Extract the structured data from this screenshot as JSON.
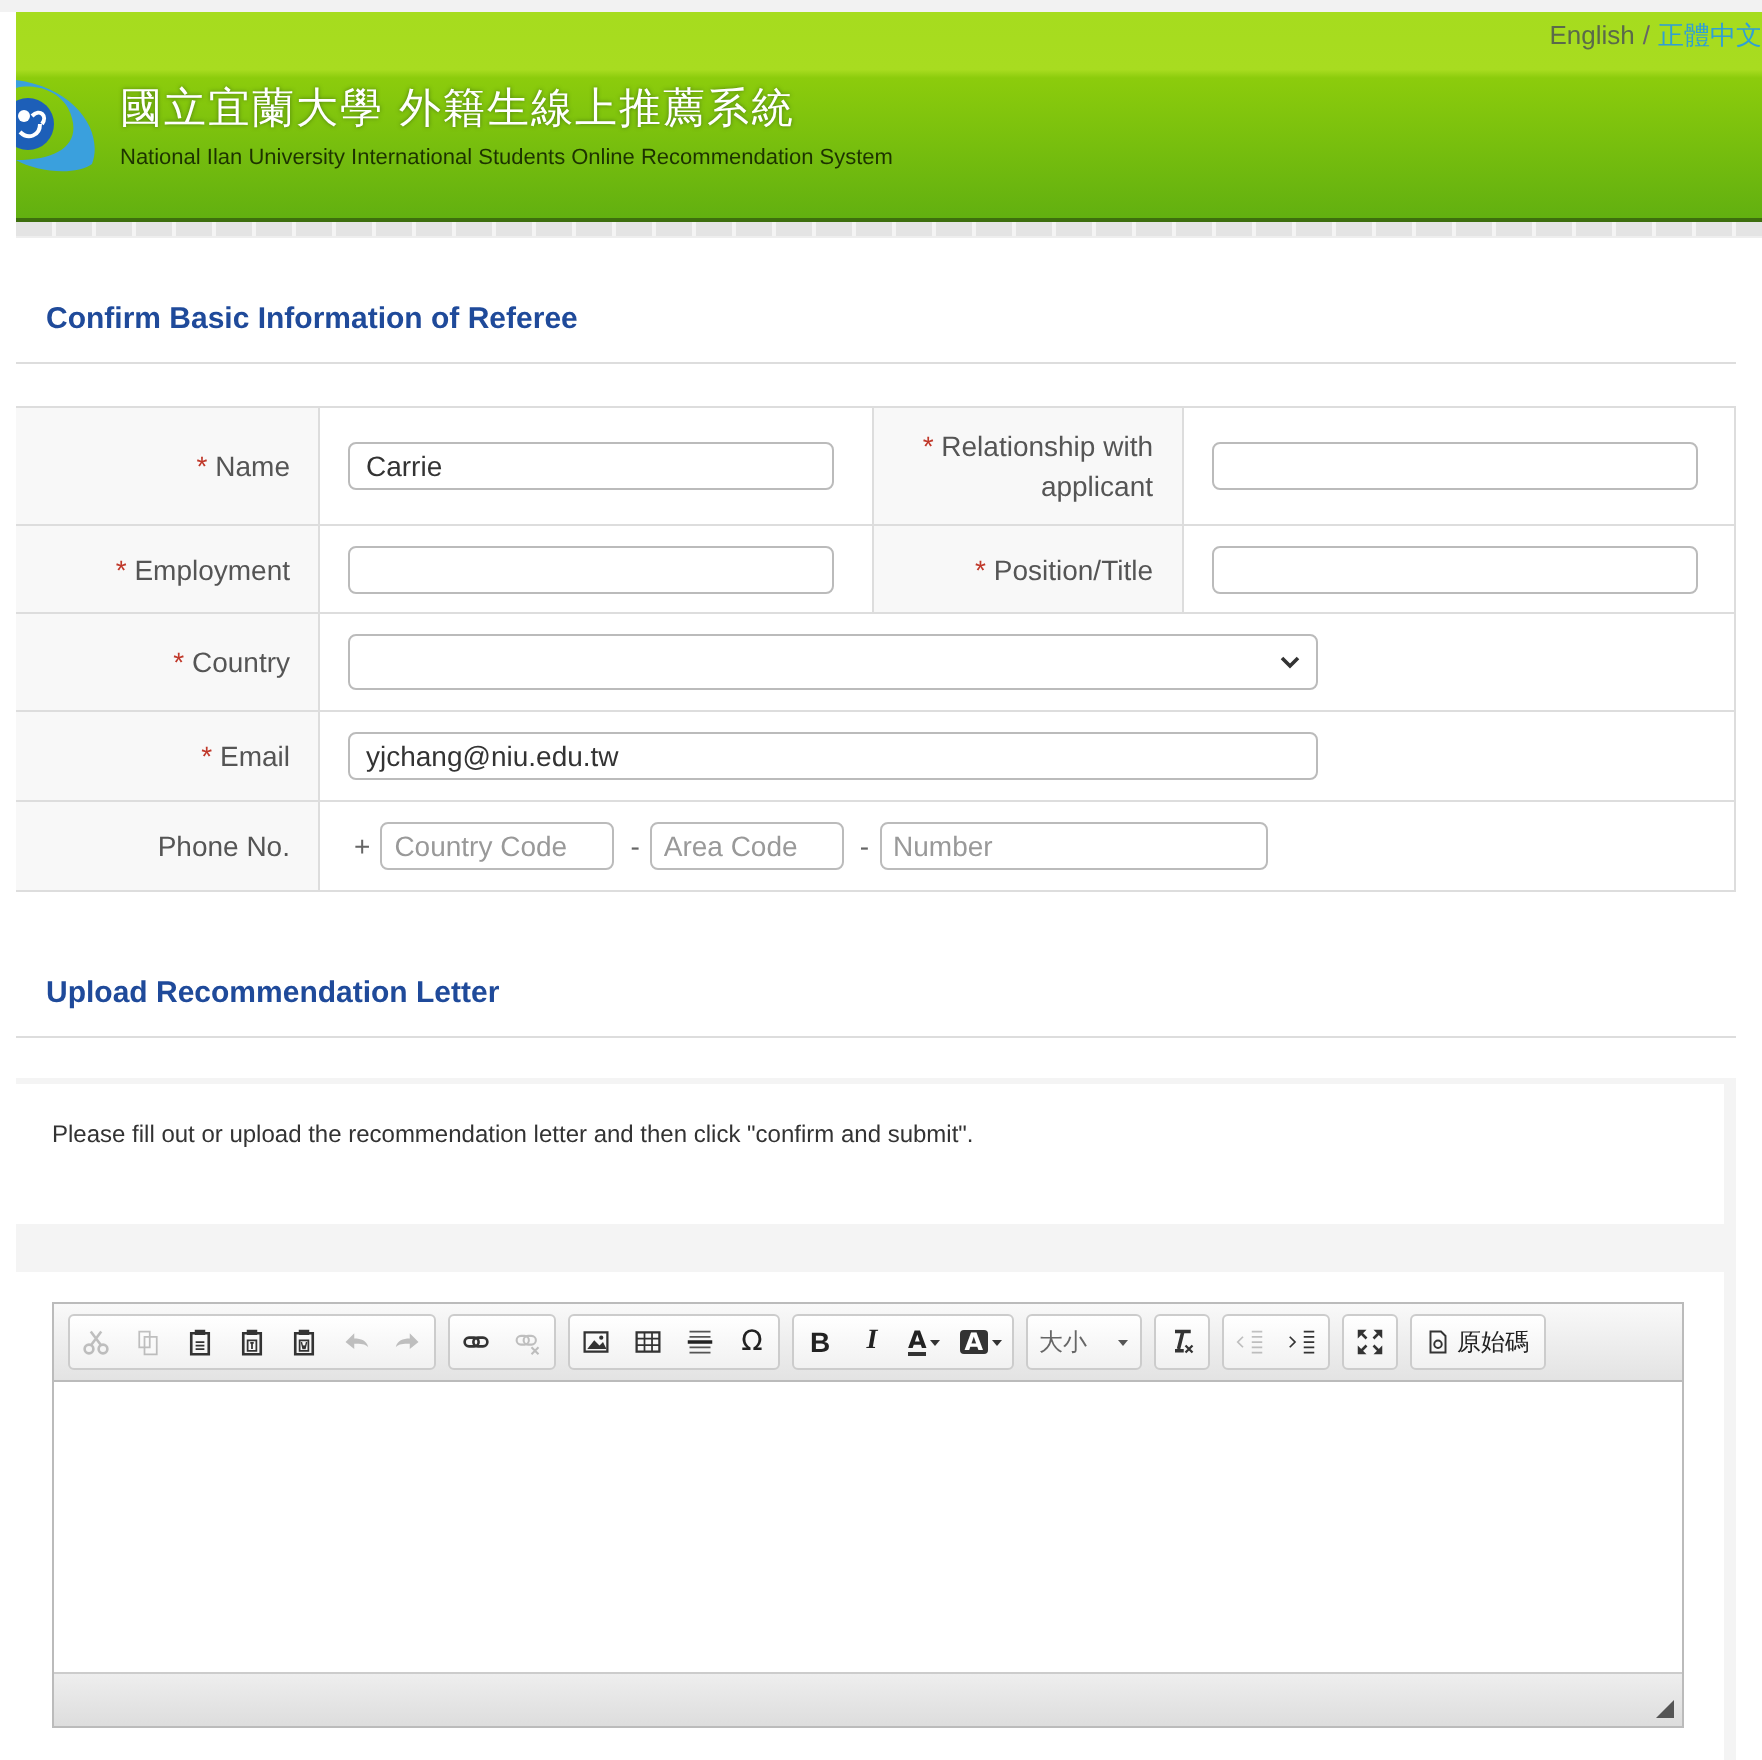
{
  "header": {
    "languages": [
      {
        "label": "English",
        "selected": true
      },
      {
        "label": "正體中文",
        "selected": false
      }
    ],
    "separator": "/",
    "title_zh": "國立宜蘭大學 外籍生線上推薦系統",
    "title_en": "National Ilan University International Students Online Recommendation System"
  },
  "basic_info": {
    "heading": "Confirm Basic Information of Referee",
    "rows": [
      {
        "fields": [
          {
            "label": "Name",
            "mark": "*",
            "kind": "text",
            "value": "Carrie"
          },
          {
            "label": "Relationship with applicant",
            "mark": "*",
            "kind": "text"
          }
        ]
      },
      {
        "fields": [
          {
            "label": "Employment",
            "mark": "*",
            "kind": "text"
          },
          {
            "label": "Position/Title",
            "mark": "*",
            "kind": "text"
          }
        ]
      },
      {
        "fields": [
          {
            "label": "Country",
            "mark": "*",
            "kind": "select"
          }
        ]
      },
      {
        "fields": [
          {
            "label": "Email",
            "mark": "*",
            "kind": "wide",
            "value": "yjchang@niu.edu.tw"
          }
        ]
      },
      {
        "fields": [
          {
            "label": "Phone No.",
            "kind": "phone",
            "parts": [
              {
                "prefix": "+",
                "placeholder": "Country Code"
              },
              {
                "prefix": "-",
                "placeholder": "Area Code"
              },
              {
                "prefix": "-",
                "placeholder": "Number"
              }
            ]
          }
        ]
      }
    ]
  },
  "upload": {
    "heading": "Upload Recommendation Letter",
    "instruction": "Please fill out or upload the recommendation letter and then click \"confirm and submit\"."
  },
  "editor": {
    "toolbar": [
      [
        {
          "kind": "cut",
          "disabled": true
        },
        {
          "kind": "copy",
          "disabled": true
        },
        {
          "kind": "paste",
          "disabled": false
        },
        {
          "kind": "paste-text",
          "disabled": false
        },
        {
          "kind": "paste-word",
          "disabled": false
        },
        {
          "kind": "undo",
          "disabled": true
        },
        {
          "kind": "redo",
          "disabled": true
        }
      ],
      [
        {
          "kind": "link",
          "disabled": false
        },
        {
          "kind": "unlink",
          "disabled": true
        }
      ],
      [
        {
          "kind": "image",
          "disabled": false
        },
        {
          "kind": "table",
          "disabled": false
        },
        {
          "kind": "hr",
          "disabled": false
        },
        {
          "kind": "glyph",
          "label": "Ω",
          "disabled": false
        }
      ],
      [
        {
          "kind": "bold",
          "label": "B",
          "disabled": false
        },
        {
          "kind": "italic",
          "label": "I",
          "disabled": false
        },
        {
          "kind": "color",
          "label": "A",
          "disabled": false
        },
        {
          "kind": "bgcolor",
          "label": "A",
          "disabled": false
        }
      ],
      [
        {
          "kind": "combo",
          "label": "大小",
          "disabled": false
        }
      ],
      [
        {
          "kind": "clear-format",
          "disabled": false
        }
      ],
      [
        {
          "kind": "outdent",
          "disabled": true
        },
        {
          "kind": "indent",
          "disabled": false
        }
      ],
      [
        {
          "kind": "maximize",
          "disabled": false
        }
      ],
      [
        {
          "kind": "source",
          "label": "原始碼",
          "disabled": false
        }
      ]
    ]
  }
}
